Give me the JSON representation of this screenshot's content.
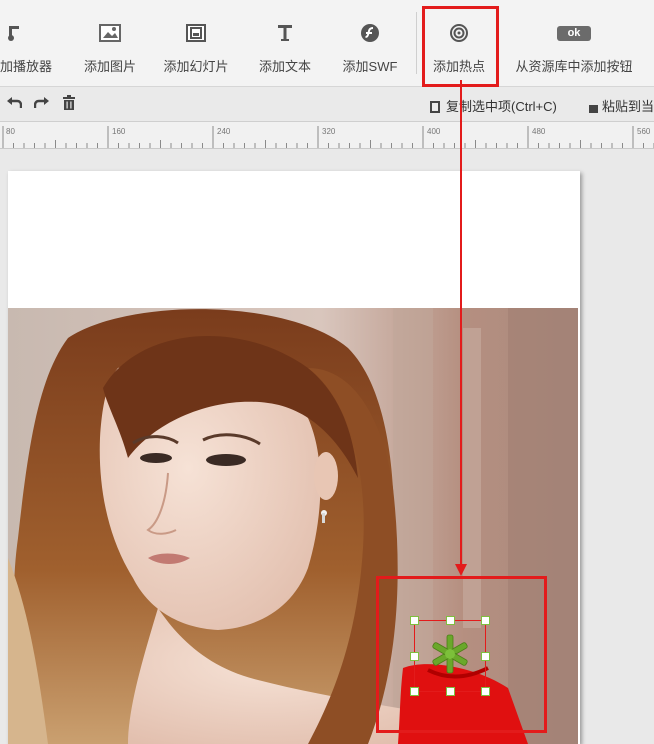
{
  "toolbar": {
    "items": [
      {
        "label": "添加播放器",
        "icon": "music-player-icon"
      },
      {
        "label": "添加图片",
        "icon": "image-icon"
      },
      {
        "label": "添加幻灯片",
        "icon": "slideshow-icon"
      },
      {
        "label": "添加文本",
        "icon": "text-icon"
      },
      {
        "label": "添加SWF",
        "icon": "flash-icon"
      },
      {
        "label": "添加热点",
        "icon": "hotspot-icon"
      },
      {
        "label": "从资源库中添加按钮",
        "icon": "ok-button-icon",
        "icon_text": "ok"
      }
    ],
    "partial_label": "放播放器"
  },
  "actions": {
    "undo_icon": "undo-icon",
    "redo_icon": "redo-icon",
    "delete_icon": "trash-icon",
    "copy_label": "复制选中项(Ctrl+C)",
    "paste_label": "粘贴到当"
  },
  "ruler": {
    "labels": [
      "80",
      "160",
      "240",
      "320",
      "400",
      "480",
      "560"
    ]
  },
  "colors": {
    "highlight": "#e31b1b",
    "hotspot_green": "#6aa82a",
    "handle_border": "#7fbf3f"
  }
}
